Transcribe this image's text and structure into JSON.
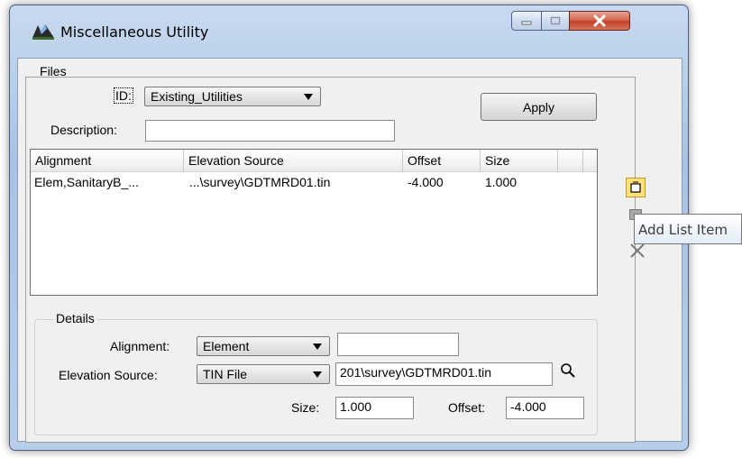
{
  "window": {
    "title": "Miscellaneous Utility"
  },
  "menu": {
    "files": "Files"
  },
  "form": {
    "id_label": "ID:",
    "id_value": "Existing_Utilities",
    "apply_label": "Apply",
    "description_label": "Description:",
    "description_value": ""
  },
  "list": {
    "columns": [
      "Alignment",
      "Elevation Source",
      "Offset",
      "Size"
    ],
    "rows": [
      [
        "Elem,SanitaryB_...",
        "...\\survey\\GDTMRD01.tin",
        "-4.000",
        "1.000"
      ]
    ]
  },
  "details": {
    "group_label": "Details",
    "alignment_label": "Alignment:",
    "alignment_value": "Element",
    "alignment_text": "",
    "elevation_label": "Elevation Source:",
    "elevation_value": "TIN File",
    "elevation_path": "201\\survey\\GDTMRD01.tin",
    "size_label": "Size:",
    "size_value": "1.000",
    "offset_label": "Offset:",
    "offset_value": "-4.000"
  },
  "tooltip": {
    "text": "Add List Item"
  },
  "colors": {
    "highlight_button": "#ffe27a",
    "close_button": "#c2412a"
  }
}
